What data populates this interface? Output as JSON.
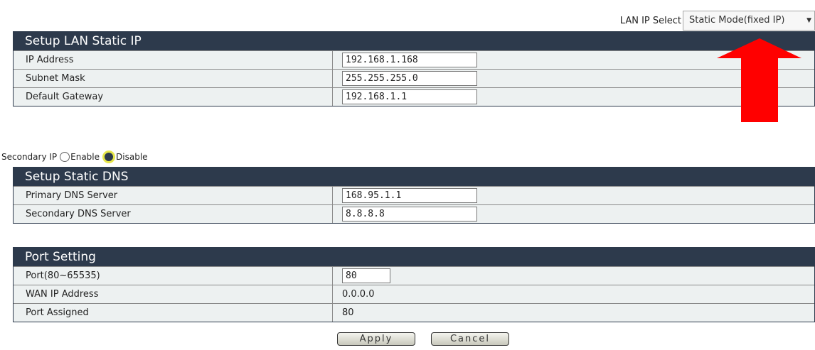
{
  "lan_ip_select": {
    "label": "LAN IP Select",
    "value": "Static Mode(fixed IP)"
  },
  "lan_static": {
    "title": "Setup LAN Static IP",
    "rows": [
      {
        "label": "IP Address",
        "value": "192.168.1.168"
      },
      {
        "label": "Subnet Mask",
        "value": "255.255.255.0"
      },
      {
        "label": "Default Gateway",
        "value": "192.168.1.1"
      }
    ]
  },
  "secondary_ip": {
    "label": "Secondary IP",
    "enable_label": "Enable",
    "disable_label": "Disable",
    "selected": "Disable"
  },
  "dns": {
    "title": "Setup Static DNS",
    "rows": [
      {
        "label": "Primary DNS Server",
        "value": "168.95.1.1"
      },
      {
        "label": "Secondary DNS Server",
        "value": "8.8.8.8"
      }
    ]
  },
  "port": {
    "title": "Port Setting",
    "rows": [
      {
        "label": "Port(80~65535)",
        "value": "80"
      },
      {
        "label": "WAN IP Address",
        "value": "0.0.0.0"
      },
      {
        "label": "Port Assigned",
        "value": "80"
      }
    ]
  },
  "buttons": {
    "apply": "Apply",
    "cancel": "Cancel"
  },
  "colors": {
    "header_bg": "#2d3a4c",
    "row_bg": "#edf1f1",
    "annotation_arrow": "#ff0000"
  }
}
